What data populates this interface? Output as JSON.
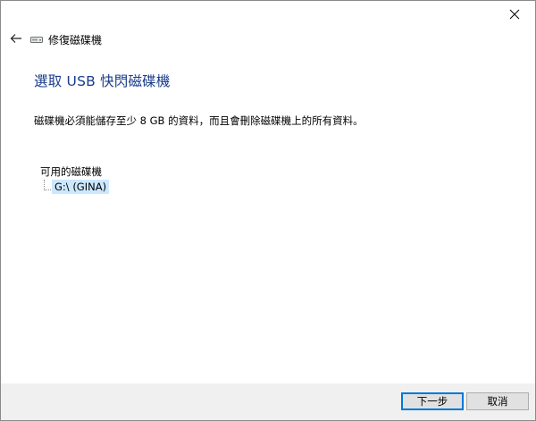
{
  "window": {
    "title": "修復磁碟機"
  },
  "icons": {
    "close": "close-icon",
    "back": "back-arrow-icon",
    "drive": "usb-drive-icon"
  },
  "main": {
    "heading": "選取 USB 快閃磁碟機",
    "description": "磁碟機必須能儲存至少 8 GB 的資料，而且會刪除磁碟機上的所有資料。",
    "tree_root_label": "可用的磁碟機",
    "drives": [
      {
        "label": "G:\\ (GINA)",
        "selected": true
      }
    ]
  },
  "footer": {
    "next_label": "下一步",
    "cancel_label": "取消"
  },
  "colors": {
    "heading": "#1a3c8a",
    "selection": "#cce8ff",
    "footer_bg": "#f0f0f0",
    "primary_border": "#0078d7"
  }
}
